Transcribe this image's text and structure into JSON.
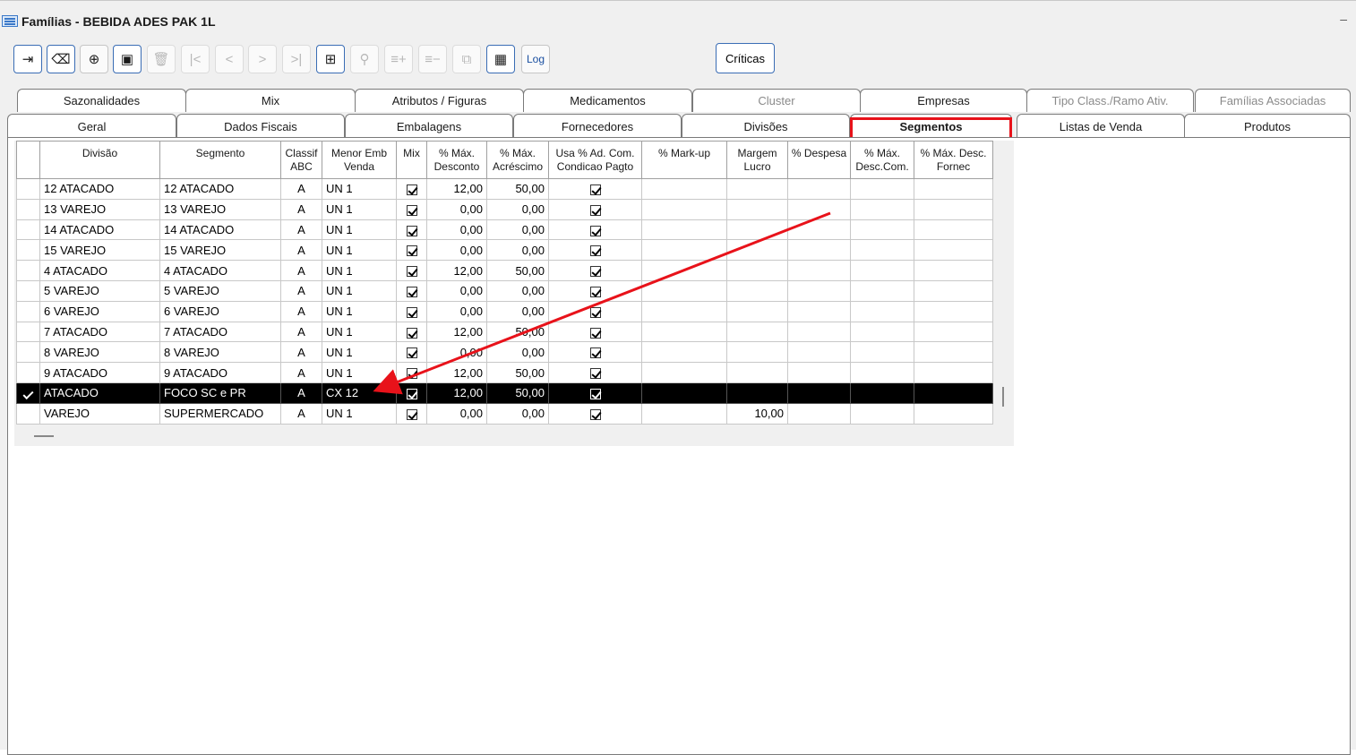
{
  "window": {
    "title": "Famílias - BEBIDA ADES PAK 1L",
    "minimize": "–"
  },
  "toolbar": {
    "buttons": [
      {
        "icon": "exit-icon",
        "glyph": "⇥"
      },
      {
        "icon": "eraser-icon",
        "glyph": "⌫"
      },
      {
        "icon": "add-icon",
        "glyph": "⊕"
      },
      {
        "icon": "save-icon",
        "glyph": "▣"
      },
      {
        "icon": "delete-icon",
        "glyph": "🗑"
      },
      {
        "icon": "first-icon",
        "glyph": "|<"
      },
      {
        "icon": "previous-icon",
        "glyph": "<"
      },
      {
        "icon": "next-icon",
        "glyph": ">"
      },
      {
        "icon": "last-icon",
        "glyph": ">|"
      },
      {
        "icon": "grid-icon",
        "glyph": "⊞"
      },
      {
        "icon": "search-icon",
        "glyph": "⚲"
      },
      {
        "icon": "add-row-icon",
        "glyph": "≡+"
      },
      {
        "icon": "remove-row-icon",
        "glyph": "≡−"
      },
      {
        "icon": "copy-icon",
        "glyph": "⧉"
      },
      {
        "icon": "calendar-icon",
        "glyph": "▦"
      }
    ],
    "log_label": "Log",
    "criticas_label": "Críticas"
  },
  "tabs_top": [
    {
      "label": "Sazonalidades",
      "enabled": true
    },
    {
      "label": "Mix",
      "enabled": true
    },
    {
      "label": "Atributos / Figuras",
      "enabled": true
    },
    {
      "label": "Medicamentos",
      "enabled": true
    },
    {
      "label": "Cluster",
      "enabled": false
    },
    {
      "label": "Empresas",
      "enabled": true
    },
    {
      "label": "Tipo Class./Ramo Ativ.",
      "enabled": false
    },
    {
      "label": "Famílias Associadas",
      "enabled": false
    }
  ],
  "tabs_bottom": [
    {
      "label": "Geral"
    },
    {
      "label": "Dados Fiscais"
    },
    {
      "label": "Embalagens"
    },
    {
      "label": "Fornecedores"
    },
    {
      "label": "Divisões"
    },
    {
      "label": "Segmentos",
      "selected": true
    },
    {
      "label": "Listas de Venda"
    },
    {
      "label": "Produtos"
    }
  ],
  "grid": {
    "columns": [
      {
        "key": "divisao",
        "label": "Divisão"
      },
      {
        "key": "segmento",
        "label": "Segmento"
      },
      {
        "key": "classif",
        "label": "Classif ABC"
      },
      {
        "key": "menor_emb",
        "label": "Menor Emb Venda"
      },
      {
        "key": "mix",
        "label": "Mix"
      },
      {
        "key": "max_desc",
        "label": "% Máx. Desconto"
      },
      {
        "key": "max_acresc",
        "label": "% Máx. Acréscimo"
      },
      {
        "key": "usa_ad",
        "label": "Usa % Ad. Com. Condicao Pagto"
      },
      {
        "key": "markup",
        "label": "% Mark-up"
      },
      {
        "key": "margem",
        "label": "Margem Lucro"
      },
      {
        "key": "despesa",
        "label": "% Despesa"
      },
      {
        "key": "desc_com",
        "label": "% Máx. Desc.Com."
      },
      {
        "key": "desc_fornec",
        "label": "% Máx. Desc. Fornec"
      }
    ],
    "rows": [
      {
        "divisao": "12 ATACADO",
        "segmento": "12 ATACADO",
        "classif": "A",
        "menor_emb": "UN 1",
        "mix": true,
        "max_desc": "12,00",
        "max_acresc": "50,00",
        "usa_ad": true,
        "markup": "",
        "margem": "",
        "despesa": "",
        "desc_com": "",
        "desc_fornec": ""
      },
      {
        "divisao": "13 VAREJO",
        "segmento": "13 VAREJO",
        "classif": "A",
        "menor_emb": "UN 1",
        "mix": true,
        "max_desc": "0,00",
        "max_acresc": "0,00",
        "usa_ad": true,
        "markup": "",
        "margem": "",
        "despesa": "",
        "desc_com": "",
        "desc_fornec": ""
      },
      {
        "divisao": "14 ATACADO",
        "segmento": "14 ATACADO",
        "classif": "A",
        "menor_emb": "UN 1",
        "mix": true,
        "max_desc": "0,00",
        "max_acresc": "0,00",
        "usa_ad": true,
        "markup": "",
        "margem": "",
        "despesa": "",
        "desc_com": "",
        "desc_fornec": ""
      },
      {
        "divisao": "15 VAREJO",
        "segmento": "15 VAREJO",
        "classif": "A",
        "menor_emb": "UN 1",
        "mix": true,
        "max_desc": "0,00",
        "max_acresc": "0,00",
        "usa_ad": true,
        "markup": "",
        "margem": "",
        "despesa": "",
        "desc_com": "",
        "desc_fornec": ""
      },
      {
        "divisao": "4 ATACADO",
        "segmento": "4 ATACADO",
        "classif": "A",
        "menor_emb": "UN 1",
        "mix": true,
        "max_desc": "12,00",
        "max_acresc": "50,00",
        "usa_ad": true,
        "markup": "",
        "margem": "",
        "despesa": "",
        "desc_com": "",
        "desc_fornec": ""
      },
      {
        "divisao": "5 VAREJO",
        "segmento": "5 VAREJO",
        "classif": "A",
        "menor_emb": "UN 1",
        "mix": true,
        "max_desc": "0,00",
        "max_acresc": "0,00",
        "usa_ad": true,
        "markup": "",
        "margem": "",
        "despesa": "",
        "desc_com": "",
        "desc_fornec": ""
      },
      {
        "divisao": "6 VAREJO",
        "segmento": "6 VAREJO",
        "classif": "A",
        "menor_emb": "UN 1",
        "mix": true,
        "max_desc": "0,00",
        "max_acresc": "0,00",
        "usa_ad": true,
        "markup": "",
        "margem": "",
        "despesa": "",
        "desc_com": "",
        "desc_fornec": ""
      },
      {
        "divisao": "7 ATACADO",
        "segmento": "7 ATACADO",
        "classif": "A",
        "menor_emb": "UN 1",
        "mix": true,
        "max_desc": "12,00",
        "max_acresc": "50,00",
        "usa_ad": true,
        "markup": "",
        "margem": "",
        "despesa": "",
        "desc_com": "",
        "desc_fornec": ""
      },
      {
        "divisao": "8 VAREJO",
        "segmento": "8 VAREJO",
        "classif": "A",
        "menor_emb": "UN 1",
        "mix": true,
        "max_desc": "0,00",
        "max_acresc": "0,00",
        "usa_ad": true,
        "markup": "",
        "margem": "",
        "despesa": "",
        "desc_com": "",
        "desc_fornec": ""
      },
      {
        "divisao": "9 ATACADO",
        "segmento": "9 ATACADO",
        "classif": "A",
        "menor_emb": "UN 1",
        "mix": true,
        "max_desc": "12,00",
        "max_acresc": "50,00",
        "usa_ad": true,
        "markup": "",
        "margem": "",
        "despesa": "",
        "desc_com": "",
        "desc_fornec": ""
      },
      {
        "divisao": "ATACADO",
        "segmento": "FOCO SC e PR",
        "classif": "A",
        "menor_emb": "CX 12",
        "mix": true,
        "max_desc": "12,00",
        "max_acresc": "50,00",
        "usa_ad": true,
        "markup": "",
        "margem": "",
        "despesa": "",
        "desc_com": "",
        "desc_fornec": "",
        "selected": true
      },
      {
        "divisao": "VAREJO",
        "segmento": "SUPERMERCADO",
        "classif": "A",
        "menor_emb": "UN 1",
        "mix": true,
        "max_desc": "0,00",
        "max_acresc": "0,00",
        "usa_ad": true,
        "markup": "",
        "margem": "10,00",
        "despesa": "",
        "desc_com": "",
        "desc_fornec": ""
      }
    ]
  },
  "annotation": {
    "color": "#e8121a",
    "highlight": "Segmentos"
  }
}
